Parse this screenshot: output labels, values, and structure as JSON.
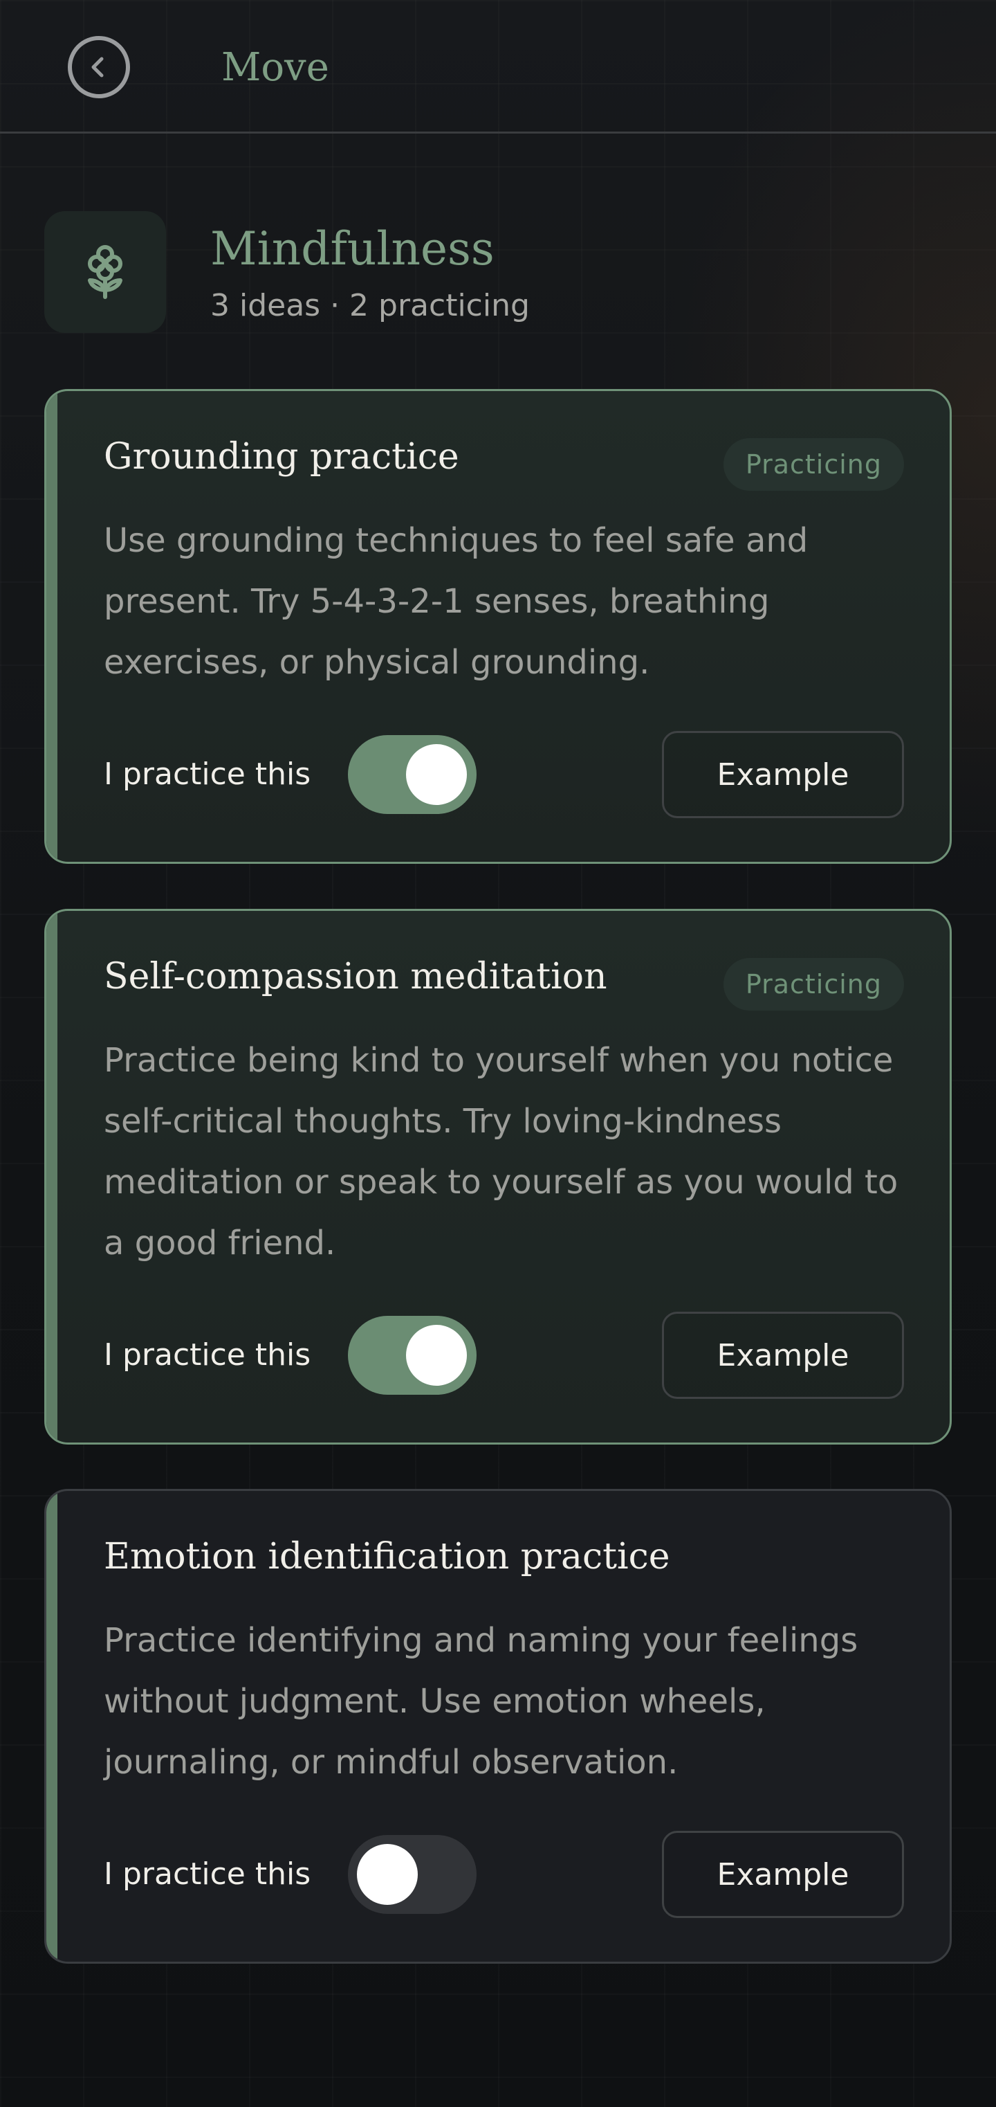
{
  "header": {
    "title": "Move",
    "back_icon": "chevron-left-circle-icon"
  },
  "section": {
    "title": "Mindfulness",
    "meta": "3 ideas · 2 practicing",
    "icon": "flower-icon"
  },
  "colors": {
    "accent": "#7e9e84",
    "toggle_on": "#6b8d73",
    "toggle_off": "#323438",
    "card_border_active": "#6f9278"
  },
  "cards": [
    {
      "title": "Grounding practice",
      "badge": "Practicing",
      "description": "Use grounding techniques to feel safe and present. Try 5-4-3-2-1 senses, breathing exercises, or physical grounding.",
      "practice_label": "I practice this",
      "practicing": true,
      "example_label": "Example"
    },
    {
      "title": "Self-compassion meditation",
      "badge": "Practicing",
      "description": "Practice being kind to yourself when you notice self-critical thoughts. Try loving-kindness meditation or speak to yourself as you would to a good friend.",
      "practice_label": "I practice this",
      "practicing": true,
      "example_label": "Example"
    },
    {
      "title": "Emotion identification practice",
      "description": "Practice identifying and naming your feelings without judgment. Use emotion wheels, journaling, or mindful observation.",
      "practice_label": "I practice this",
      "practicing": false,
      "example_label": "Example"
    }
  ]
}
